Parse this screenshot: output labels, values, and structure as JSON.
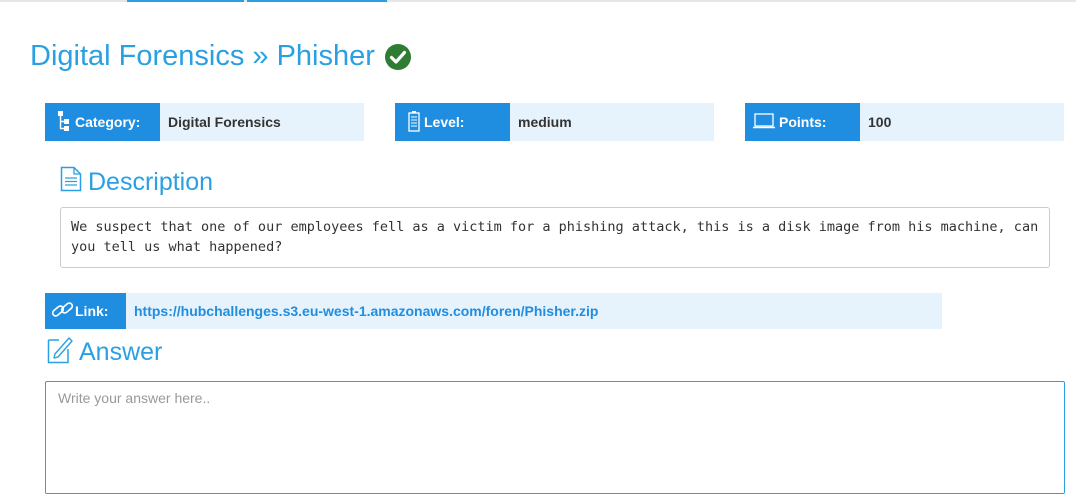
{
  "header": {
    "title": "Digital Forensics » Phisher"
  },
  "info": {
    "category_label": "Category:",
    "category_value": "Digital Forensics",
    "level_label": "Level:",
    "level_value": "medium",
    "points_label": "Points:",
    "points_value": "100"
  },
  "description": {
    "heading": "Description",
    "text": "We suspect that one of our employees fell as a victim for a phishing attack, this is a disk image from his machine, can you tell us what happened?"
  },
  "link": {
    "label": "Link:",
    "url": "https://hubchallenges.s3.eu-west-1.amazonaws.com/foren/Phisher.zip"
  },
  "answer": {
    "heading": "Answer",
    "placeholder": "Write your answer here.."
  },
  "colors": {
    "accent": "#2aa0e3",
    "label_bg": "#1f8ee0",
    "value_bg": "#e6f3fc",
    "success": "#2e7d32"
  },
  "icons": {
    "solved": "check-circle-icon",
    "category": "sitemap-icon",
    "level": "battery-icon",
    "points": "laptop-icon",
    "description": "document-icon",
    "link": "link-icon",
    "answer": "edit-icon"
  }
}
